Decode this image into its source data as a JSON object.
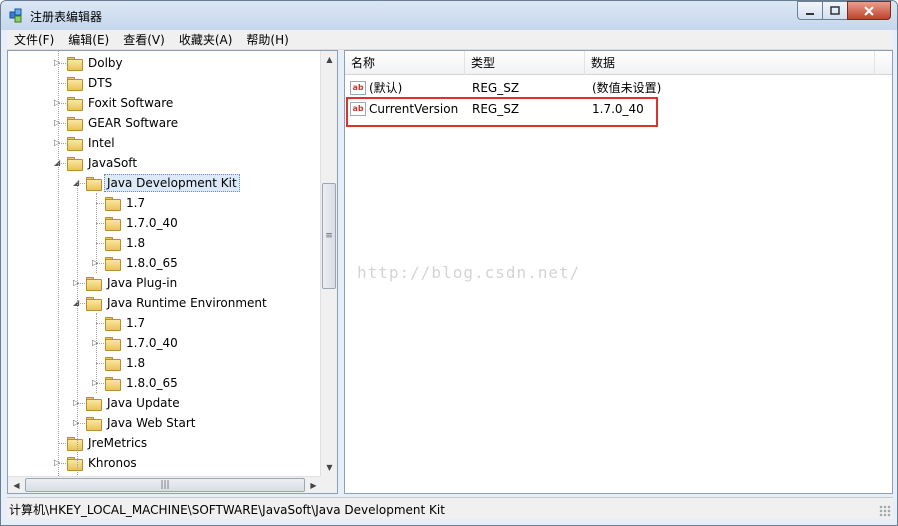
{
  "window": {
    "title": "注册表编辑器"
  },
  "menu": [
    "文件(F)",
    "编辑(E)",
    "查看(V)",
    "收藏夹(A)",
    "帮助(H)"
  ],
  "tree": [
    {
      "label": "Dolby",
      "level": 1,
      "expander": "closed"
    },
    {
      "label": "DTS",
      "level": 1,
      "expander": "none"
    },
    {
      "label": "Foxit Software",
      "level": 1,
      "expander": "closed"
    },
    {
      "label": "GEAR Software",
      "level": 1,
      "expander": "closed"
    },
    {
      "label": "Intel",
      "level": 1,
      "expander": "closed"
    },
    {
      "label": "JavaSoft",
      "level": 1,
      "expander": "open"
    },
    {
      "label": "Java Development Kit",
      "level": 2,
      "expander": "open",
      "selected": true
    },
    {
      "label": "1.7",
      "level": 3,
      "expander": "none"
    },
    {
      "label": "1.7.0_40",
      "level": 3,
      "expander": "none"
    },
    {
      "label": "1.8",
      "level": 3,
      "expander": "none"
    },
    {
      "label": "1.8.0_65",
      "level": 3,
      "expander": "closed"
    },
    {
      "label": "Java Plug-in",
      "level": 2,
      "expander": "closed"
    },
    {
      "label": "Java Runtime Environment",
      "level": 2,
      "expander": "open"
    },
    {
      "label": "1.7",
      "level": 3,
      "expander": "none"
    },
    {
      "label": "1.7.0_40",
      "level": 3,
      "expander": "closed"
    },
    {
      "label": "1.8",
      "level": 3,
      "expander": "none"
    },
    {
      "label": "1.8.0_65",
      "level": 3,
      "expander": "closed"
    },
    {
      "label": "Java Update",
      "level": 2,
      "expander": "closed"
    },
    {
      "label": "Java Web Start",
      "level": 2,
      "expander": "closed"
    },
    {
      "label": "JreMetrics",
      "level": 1,
      "expander": "none"
    },
    {
      "label": "Khronos",
      "level": 1,
      "expander": "closed"
    }
  ],
  "list": {
    "columns": [
      "名称",
      "类型",
      "数据"
    ],
    "rows": [
      {
        "name": "(默认)",
        "type": "REG_SZ",
        "data": "(数值未设置)",
        "icon": "ab-icon"
      },
      {
        "name": "CurrentVersion",
        "type": "REG_SZ",
        "data": "1.7.0_40",
        "icon": "ab-icon",
        "highlighted": true
      }
    ]
  },
  "watermark": "http://blog.csdn.net/",
  "status": "计算机\\HKEY_LOCAL_MACHINE\\SOFTWARE\\JavaSoft\\Java Development Kit",
  "colors": {
    "highlight_border": "#e0302a",
    "window_frame": "#c6d7ec",
    "selection": "#dce9f8"
  }
}
